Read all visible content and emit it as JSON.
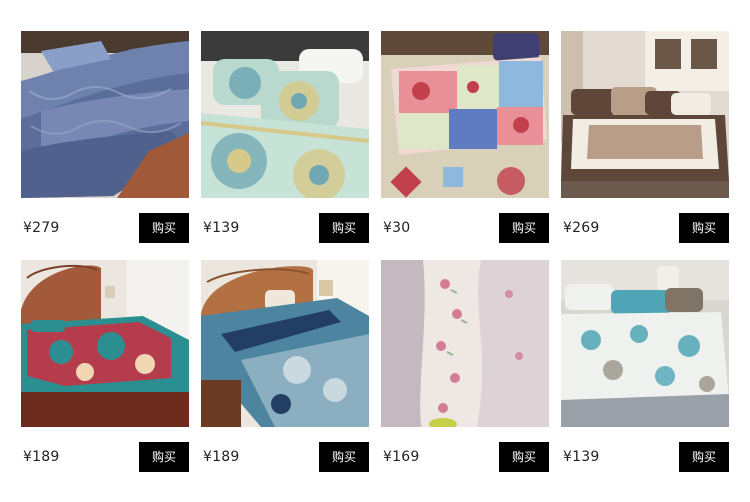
{
  "products": [
    {
      "price": "¥279",
      "buy_label": "购买",
      "image": "blue-comforter-bed-photo",
      "palette": [
        "#5b6e9a",
        "#7f8fb8",
        "#3f4f79",
        "#a05a3a"
      ]
    },
    {
      "price": "¥139",
      "buy_label": "购买",
      "image": "medallion-quilt-pillows-photo",
      "palette": [
        "#b9d9cf",
        "#d6c989",
        "#6fa7b3",
        "#f1f1ea"
      ]
    },
    {
      "price": "¥30",
      "buy_label": "购买",
      "image": "patchwork-pillow-photo",
      "palette": [
        "#e98f98",
        "#8fb8df",
        "#d8d0b8",
        "#c23f4c"
      ]
    },
    {
      "price": "¥269",
      "buy_label": "购买",
      "image": "brown-cream-bedding-photo",
      "palette": [
        "#f1ede3",
        "#5e4638",
        "#b89e88",
        "#e2dad0"
      ]
    },
    {
      "price": "¥189",
      "buy_label": "购买",
      "image": "red-teal-paisley-quilt-photo",
      "palette": [
        "#2b8f91",
        "#cc2e3f",
        "#a25a3b",
        "#6d2b1e"
      ]
    },
    {
      "price": "¥189",
      "buy_label": "购买",
      "image": "blue-paisley-quilt-photo",
      "palette": [
        "#4d84a0",
        "#233e63",
        "#b27043",
        "#d8e3e6"
      ]
    },
    {
      "price": "¥169",
      "buy_label": "购买",
      "image": "floral-quilt-closeup-photo",
      "palette": [
        "#e8dde0",
        "#d37d94",
        "#c3b9bf",
        "#9bb491"
      ]
    },
    {
      "price": "¥139",
      "buy_label": "购买",
      "image": "seashell-quilt-bed-photo",
      "palette": [
        "#eef1ee",
        "#4fa5b5",
        "#7f7465",
        "#d9d5cf"
      ]
    }
  ]
}
